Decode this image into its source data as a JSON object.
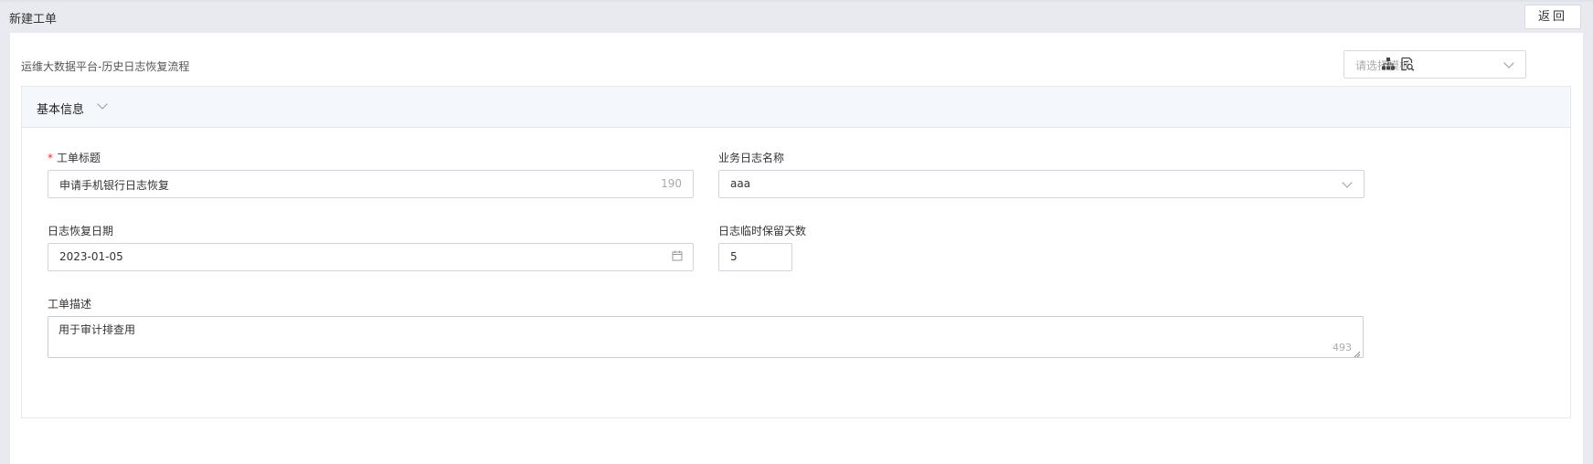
{
  "header": {
    "title": "新建工单",
    "back_label": "返回"
  },
  "panel": {
    "flow_name": "运维大数据平台-历史日志恢复流程",
    "template_placeholder": "请选择模板",
    "icons": [
      "org-chart-icon",
      "document-search-icon"
    ]
  },
  "section": {
    "title": "基本信息"
  },
  "form": {
    "ticket_title": {
      "label": "工单标题",
      "required_mark": "*",
      "value": "申请手机银行日志恢复",
      "counter": "190"
    },
    "log_name": {
      "label": "业务日志名称",
      "value": "aaa"
    },
    "restore_date": {
      "label": "日志恢复日期",
      "value": "2023-01-05"
    },
    "retention_days": {
      "label": "日志临时保留天数",
      "value": "5"
    },
    "description": {
      "label": "工单描述",
      "value": "用于审计排查用",
      "counter": "493"
    }
  }
}
